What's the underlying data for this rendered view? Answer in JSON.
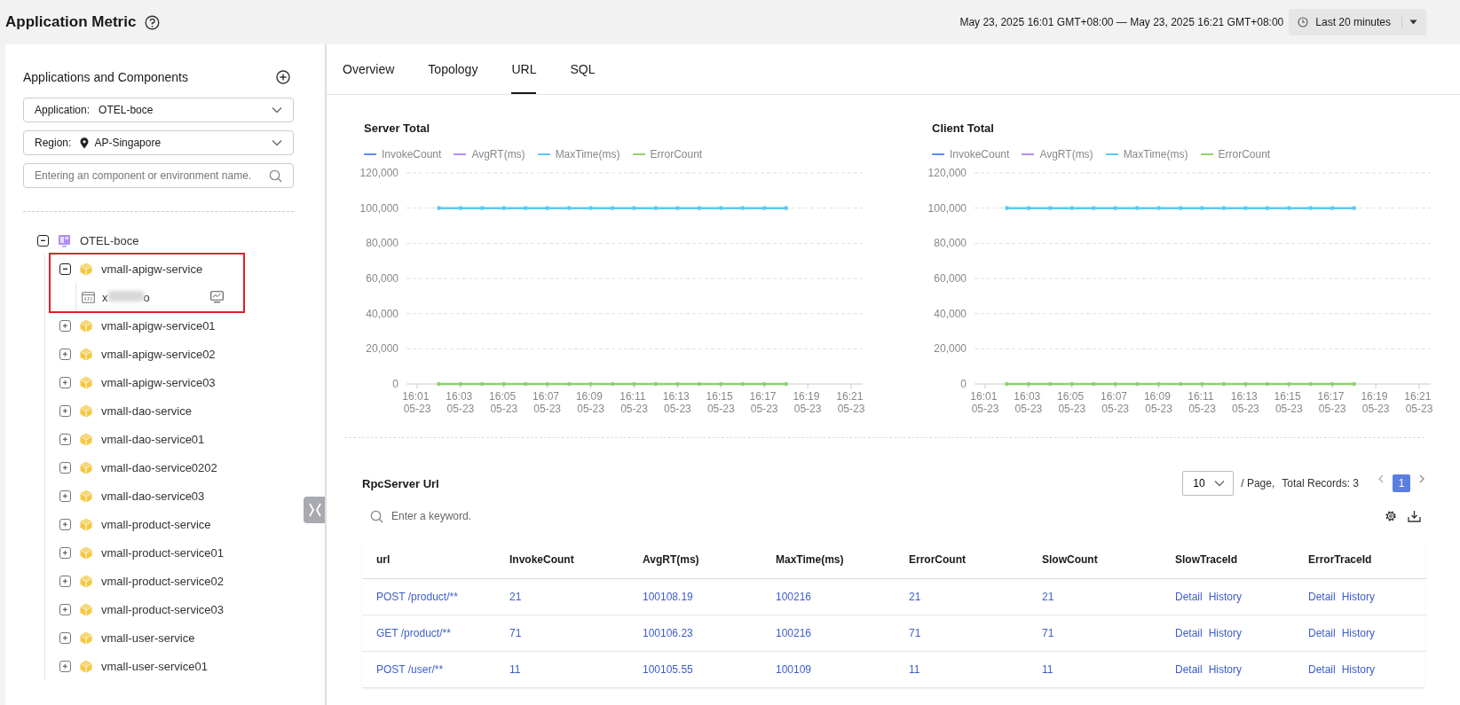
{
  "header": {
    "title": "Application Metric",
    "time_range": "May 23, 2025 16:01 GMT+08:00 — May 23, 2025 16:21 GMT+08:00",
    "time_preset": "Last 20 minutes"
  },
  "sidebar": {
    "title": "Applications and Components",
    "application": {
      "label": "Application:",
      "value": "OTEL-boce"
    },
    "region": {
      "label": "Region:",
      "value": "AP-Singapore"
    },
    "search": {
      "placeholder": "Entering an component or environment name."
    },
    "tree": [
      {
        "label": "OTEL-boce",
        "kind": "application",
        "expanded": true,
        "highlighted": false,
        "children": [
          {
            "label": "vmall-apigw-service",
            "kind": "component",
            "expanded": true,
            "highlighted": true,
            "children": [
              {
                "kind": "environment",
                "label_start": "x",
                "label_end": "o"
              }
            ]
          },
          {
            "label": "vmall-apigw-service01",
            "kind": "component",
            "expanded": false,
            "highlighted": false
          },
          {
            "label": "vmall-apigw-service02",
            "kind": "component",
            "expanded": false,
            "highlighted": false
          },
          {
            "label": "vmall-apigw-service03",
            "kind": "component",
            "expanded": false,
            "highlighted": false
          },
          {
            "label": "vmall-dao-service",
            "kind": "component",
            "expanded": false,
            "highlighted": false
          },
          {
            "label": "vmall-dao-service01",
            "kind": "component",
            "expanded": false,
            "highlighted": false
          },
          {
            "label": "vmall-dao-service0202",
            "kind": "component",
            "expanded": false,
            "highlighted": false
          },
          {
            "label": "vmall-dao-service03",
            "kind": "component",
            "expanded": false,
            "highlighted": false
          },
          {
            "label": "vmall-product-service",
            "kind": "component",
            "expanded": false,
            "highlighted": false
          },
          {
            "label": "vmall-product-service01",
            "kind": "component",
            "expanded": false,
            "highlighted": false
          },
          {
            "label": "vmall-product-service02",
            "kind": "component",
            "expanded": false,
            "highlighted": false
          },
          {
            "label": "vmall-product-service03",
            "kind": "component",
            "expanded": false,
            "highlighted": false
          },
          {
            "label": "vmall-user-service",
            "kind": "component",
            "expanded": false,
            "highlighted": false
          },
          {
            "label": "vmall-user-service01",
            "kind": "component",
            "expanded": false,
            "highlighted": false
          }
        ]
      }
    ]
  },
  "tabs": [
    {
      "label": "Overview",
      "selected": false
    },
    {
      "label": "Topology",
      "selected": false
    },
    {
      "label": "URL",
      "selected": true
    },
    {
      "label": "SQL",
      "selected": false
    }
  ],
  "charts": [
    {
      "chart_data": {
        "type": "line",
        "title": "Server Total",
        "grid": true,
        "categories": [
          "16:01 05-23",
          null,
          "16:03 05-23",
          null,
          "16:05 05-23",
          null,
          "16:07 05-23",
          null,
          "16:09 05-23",
          null,
          "16:11 05-23",
          null,
          "16:13 05-23",
          null,
          "16:15 05-23",
          null,
          "16:17 05-23",
          null,
          "16:19 05-23",
          null,
          "16:21 05-23"
        ],
        "series": [
          {
            "name": "InvokeCount",
            "color": "#5b8ff9",
            "values": [
              null,
              null,
              null,
              null,
              null,
              null,
              null,
              null,
              null,
              null,
              null,
              null,
              null,
              null,
              null,
              null,
              null,
              null,
              null,
              null,
              null
            ]
          },
          {
            "name": "AvgRT(ms)",
            "color": "#b78cf0",
            "values": [
              null,
              null,
              null,
              null,
              null,
              null,
              null,
              null,
              null,
              null,
              null,
              null,
              null,
              null,
              null,
              null,
              null,
              null,
              null,
              null,
              null
            ]
          },
          {
            "name": "MaxTime(ms)",
            "color": "#5ccbf0",
            "values": [
              null,
              100000,
              100000,
              100000,
              100000,
              100000,
              100000,
              100000,
              100000,
              100000,
              100000,
              100000,
              100000,
              100000,
              100000,
              100000,
              100000,
              100000,
              null,
              null,
              null
            ]
          },
          {
            "name": "ErrorCount",
            "color": "#8fd16e",
            "values": [
              null,
              0,
              0,
              0,
              0,
              0,
              0,
              0,
              0,
              0,
              0,
              0,
              0,
              0,
              0,
              0,
              0,
              0,
              null,
              null,
              null
            ]
          }
        ],
        "ylim": [
          0,
          120000
        ],
        "yticks": [
          {
            "value": 0,
            "label": "0"
          },
          {
            "value": 20000,
            "label": "20,000"
          },
          {
            "value": 40000,
            "label": "40,000"
          },
          {
            "value": 60000,
            "label": "60,000"
          },
          {
            "value": 80000,
            "label": "80,000"
          },
          {
            "value": 100000,
            "label": "100,000"
          },
          {
            "value": 120000,
            "label": "120,000"
          }
        ]
      }
    },
    {
      "chart_data": {
        "type": "line",
        "title": "Client Total",
        "grid": true,
        "categories": [
          "16:01 05-23",
          null,
          "16:03 05-23",
          null,
          "16:05 05-23",
          null,
          "16:07 05-23",
          null,
          "16:09 05-23",
          null,
          "16:11 05-23",
          null,
          "16:13 05-23",
          null,
          "16:15 05-23",
          null,
          "16:17 05-23",
          null,
          "16:19 05-23",
          null,
          "16:21 05-23"
        ],
        "series": [
          {
            "name": "InvokeCount",
            "color": "#5b8ff9",
            "values": [
              null,
              null,
              null,
              null,
              null,
              null,
              null,
              null,
              null,
              null,
              null,
              null,
              null,
              null,
              null,
              null,
              null,
              null,
              null,
              null,
              null
            ]
          },
          {
            "name": "AvgRT(ms)",
            "color": "#b78cf0",
            "values": [
              null,
              null,
              null,
              null,
              null,
              null,
              null,
              null,
              null,
              null,
              null,
              null,
              null,
              null,
              null,
              null,
              null,
              null,
              null,
              null,
              null
            ]
          },
          {
            "name": "MaxTime(ms)",
            "color": "#5ccbf0",
            "values": [
              null,
              100000,
              100000,
              100000,
              100000,
              100000,
              100000,
              100000,
              100000,
              100000,
              100000,
              100000,
              100000,
              100000,
              100000,
              100000,
              100000,
              100000,
              null,
              null,
              null
            ]
          },
          {
            "name": "ErrorCount",
            "color": "#8fd16e",
            "values": [
              null,
              0,
              0,
              0,
              0,
              0,
              0,
              0,
              0,
              0,
              0,
              0,
              0,
              0,
              0,
              0,
              0,
              0,
              null,
              null,
              null
            ]
          }
        ],
        "ylim": [
          0,
          120000
        ],
        "yticks": [
          {
            "value": 0,
            "label": "0"
          },
          {
            "value": 20000,
            "label": "20,000"
          },
          {
            "value": 40000,
            "label": "40,000"
          },
          {
            "value": 60000,
            "label": "60,000"
          },
          {
            "value": 80000,
            "label": "80,000"
          },
          {
            "value": 100000,
            "label": "100,000"
          },
          {
            "value": 120000,
            "label": "120,000"
          }
        ]
      }
    }
  ],
  "table": {
    "title": "RpcServer Url",
    "page_size": "10",
    "page_size_suffix": "/ Page,",
    "total": "Total Records: 3",
    "pages": [
      {
        "label": "1",
        "selected": true
      }
    ],
    "search": {
      "placeholder": "Enter a keyword."
    },
    "columns": [
      "url",
      "InvokeCount",
      "AvgRT(ms)",
      "MaxTime(ms)",
      "ErrorCount",
      "SlowCount",
      "SlowTraceId",
      "ErrorTraceId"
    ],
    "rows": [
      {
        "cells": [
          "POST /product/**",
          "21",
          "100108.19",
          "100216",
          "21",
          "21"
        ],
        "slow_trace_links": [
          "Detail",
          "History"
        ],
        "error_trace_links": [
          "Detail",
          "History"
        ]
      },
      {
        "cells": [
          "GET /product/**",
          "71",
          "100106.23",
          "100216",
          "71",
          "71"
        ],
        "slow_trace_links": [
          "Detail",
          "History"
        ],
        "error_trace_links": [
          "Detail",
          "History"
        ]
      },
      {
        "cells": [
          "POST /user/**",
          "11",
          "100105.55",
          "100109",
          "11",
          "11"
        ],
        "slow_trace_links": [
          "Detail",
          "History"
        ],
        "error_trace_links": [
          "Detail",
          "History"
        ]
      }
    ]
  }
}
